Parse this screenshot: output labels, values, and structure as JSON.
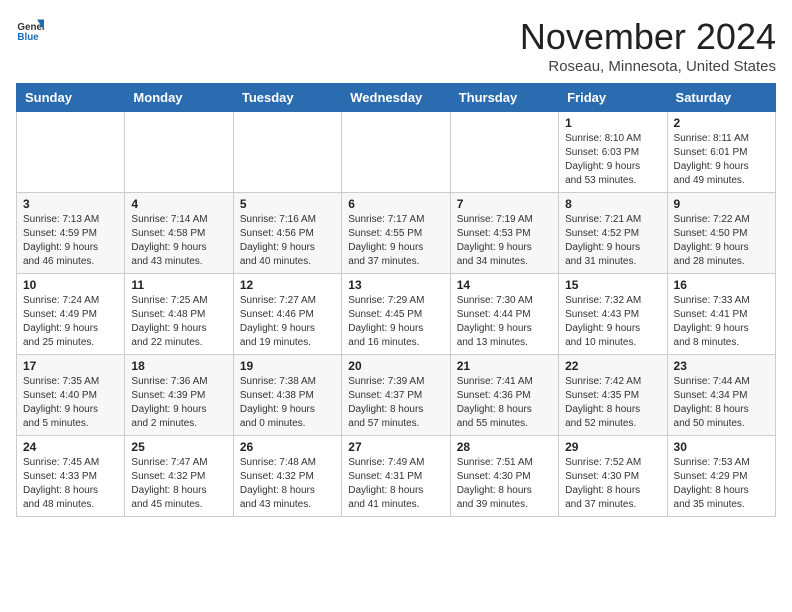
{
  "header": {
    "logo_general": "General",
    "logo_blue": "Blue",
    "month_title": "November 2024",
    "location": "Roseau, Minnesota, United States"
  },
  "days_of_week": [
    "Sunday",
    "Monday",
    "Tuesday",
    "Wednesday",
    "Thursday",
    "Friday",
    "Saturday"
  ],
  "weeks": [
    [
      {
        "day": "",
        "detail": ""
      },
      {
        "day": "",
        "detail": ""
      },
      {
        "day": "",
        "detail": ""
      },
      {
        "day": "",
        "detail": ""
      },
      {
        "day": "",
        "detail": ""
      },
      {
        "day": "1",
        "detail": "Sunrise: 8:10 AM\nSunset: 6:03 PM\nDaylight: 9 hours\nand 53 minutes."
      },
      {
        "day": "2",
        "detail": "Sunrise: 8:11 AM\nSunset: 6:01 PM\nDaylight: 9 hours\nand 49 minutes."
      }
    ],
    [
      {
        "day": "3",
        "detail": "Sunrise: 7:13 AM\nSunset: 4:59 PM\nDaylight: 9 hours\nand 46 minutes."
      },
      {
        "day": "4",
        "detail": "Sunrise: 7:14 AM\nSunset: 4:58 PM\nDaylight: 9 hours\nand 43 minutes."
      },
      {
        "day": "5",
        "detail": "Sunrise: 7:16 AM\nSunset: 4:56 PM\nDaylight: 9 hours\nand 40 minutes."
      },
      {
        "day": "6",
        "detail": "Sunrise: 7:17 AM\nSunset: 4:55 PM\nDaylight: 9 hours\nand 37 minutes."
      },
      {
        "day": "7",
        "detail": "Sunrise: 7:19 AM\nSunset: 4:53 PM\nDaylight: 9 hours\nand 34 minutes."
      },
      {
        "day": "8",
        "detail": "Sunrise: 7:21 AM\nSunset: 4:52 PM\nDaylight: 9 hours\nand 31 minutes."
      },
      {
        "day": "9",
        "detail": "Sunrise: 7:22 AM\nSunset: 4:50 PM\nDaylight: 9 hours\nand 28 minutes."
      }
    ],
    [
      {
        "day": "10",
        "detail": "Sunrise: 7:24 AM\nSunset: 4:49 PM\nDaylight: 9 hours\nand 25 minutes."
      },
      {
        "day": "11",
        "detail": "Sunrise: 7:25 AM\nSunset: 4:48 PM\nDaylight: 9 hours\nand 22 minutes."
      },
      {
        "day": "12",
        "detail": "Sunrise: 7:27 AM\nSunset: 4:46 PM\nDaylight: 9 hours\nand 19 minutes."
      },
      {
        "day": "13",
        "detail": "Sunrise: 7:29 AM\nSunset: 4:45 PM\nDaylight: 9 hours\nand 16 minutes."
      },
      {
        "day": "14",
        "detail": "Sunrise: 7:30 AM\nSunset: 4:44 PM\nDaylight: 9 hours\nand 13 minutes."
      },
      {
        "day": "15",
        "detail": "Sunrise: 7:32 AM\nSunset: 4:43 PM\nDaylight: 9 hours\nand 10 minutes."
      },
      {
        "day": "16",
        "detail": "Sunrise: 7:33 AM\nSunset: 4:41 PM\nDaylight: 9 hours\nand 8 minutes."
      }
    ],
    [
      {
        "day": "17",
        "detail": "Sunrise: 7:35 AM\nSunset: 4:40 PM\nDaylight: 9 hours\nand 5 minutes."
      },
      {
        "day": "18",
        "detail": "Sunrise: 7:36 AM\nSunset: 4:39 PM\nDaylight: 9 hours\nand 2 minutes."
      },
      {
        "day": "19",
        "detail": "Sunrise: 7:38 AM\nSunset: 4:38 PM\nDaylight: 9 hours\nand 0 minutes."
      },
      {
        "day": "20",
        "detail": "Sunrise: 7:39 AM\nSunset: 4:37 PM\nDaylight: 8 hours\nand 57 minutes."
      },
      {
        "day": "21",
        "detail": "Sunrise: 7:41 AM\nSunset: 4:36 PM\nDaylight: 8 hours\nand 55 minutes."
      },
      {
        "day": "22",
        "detail": "Sunrise: 7:42 AM\nSunset: 4:35 PM\nDaylight: 8 hours\nand 52 minutes."
      },
      {
        "day": "23",
        "detail": "Sunrise: 7:44 AM\nSunset: 4:34 PM\nDaylight: 8 hours\nand 50 minutes."
      }
    ],
    [
      {
        "day": "24",
        "detail": "Sunrise: 7:45 AM\nSunset: 4:33 PM\nDaylight: 8 hours\nand 48 minutes."
      },
      {
        "day": "25",
        "detail": "Sunrise: 7:47 AM\nSunset: 4:32 PM\nDaylight: 8 hours\nand 45 minutes."
      },
      {
        "day": "26",
        "detail": "Sunrise: 7:48 AM\nSunset: 4:32 PM\nDaylight: 8 hours\nand 43 minutes."
      },
      {
        "day": "27",
        "detail": "Sunrise: 7:49 AM\nSunset: 4:31 PM\nDaylight: 8 hours\nand 41 minutes."
      },
      {
        "day": "28",
        "detail": "Sunrise: 7:51 AM\nSunset: 4:30 PM\nDaylight: 8 hours\nand 39 minutes."
      },
      {
        "day": "29",
        "detail": "Sunrise: 7:52 AM\nSunset: 4:30 PM\nDaylight: 8 hours\nand 37 minutes."
      },
      {
        "day": "30",
        "detail": "Sunrise: 7:53 AM\nSunset: 4:29 PM\nDaylight: 8 hours\nand 35 minutes."
      }
    ]
  ]
}
